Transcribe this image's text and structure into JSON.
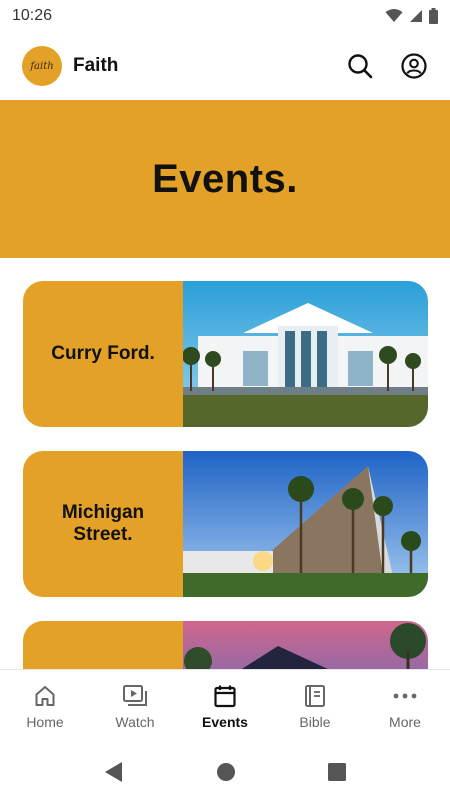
{
  "status": {
    "time": "10:26",
    "icons": [
      "wifi-icon",
      "signal-icon",
      "battery-icon"
    ]
  },
  "app_bar": {
    "logo_text": "faith",
    "title": "Faith",
    "actions": [
      "search-icon",
      "account-icon"
    ]
  },
  "hero": {
    "title": "Events."
  },
  "events": [
    {
      "label": "Curry Ford.",
      "image": "white church building with palm trees"
    },
    {
      "label": "Michigan\nStreet.",
      "image": "A-frame stone church with palm trees"
    },
    {
      "label": "",
      "image": "church roof at sunset"
    }
  ],
  "bottom_nav": {
    "items": [
      {
        "label": "Home",
        "icon": "home-icon",
        "active": false
      },
      {
        "label": "Watch",
        "icon": "play-icon",
        "active": false
      },
      {
        "label": "Events",
        "icon": "calendar-icon",
        "active": true
      },
      {
        "label": "Bible",
        "icon": "book-icon",
        "active": false
      },
      {
        "label": "More",
        "icon": "more-icon",
        "active": false
      }
    ]
  },
  "colors": {
    "brand": "#e3a127",
    "text": "#111111",
    "muted": "#666666"
  }
}
